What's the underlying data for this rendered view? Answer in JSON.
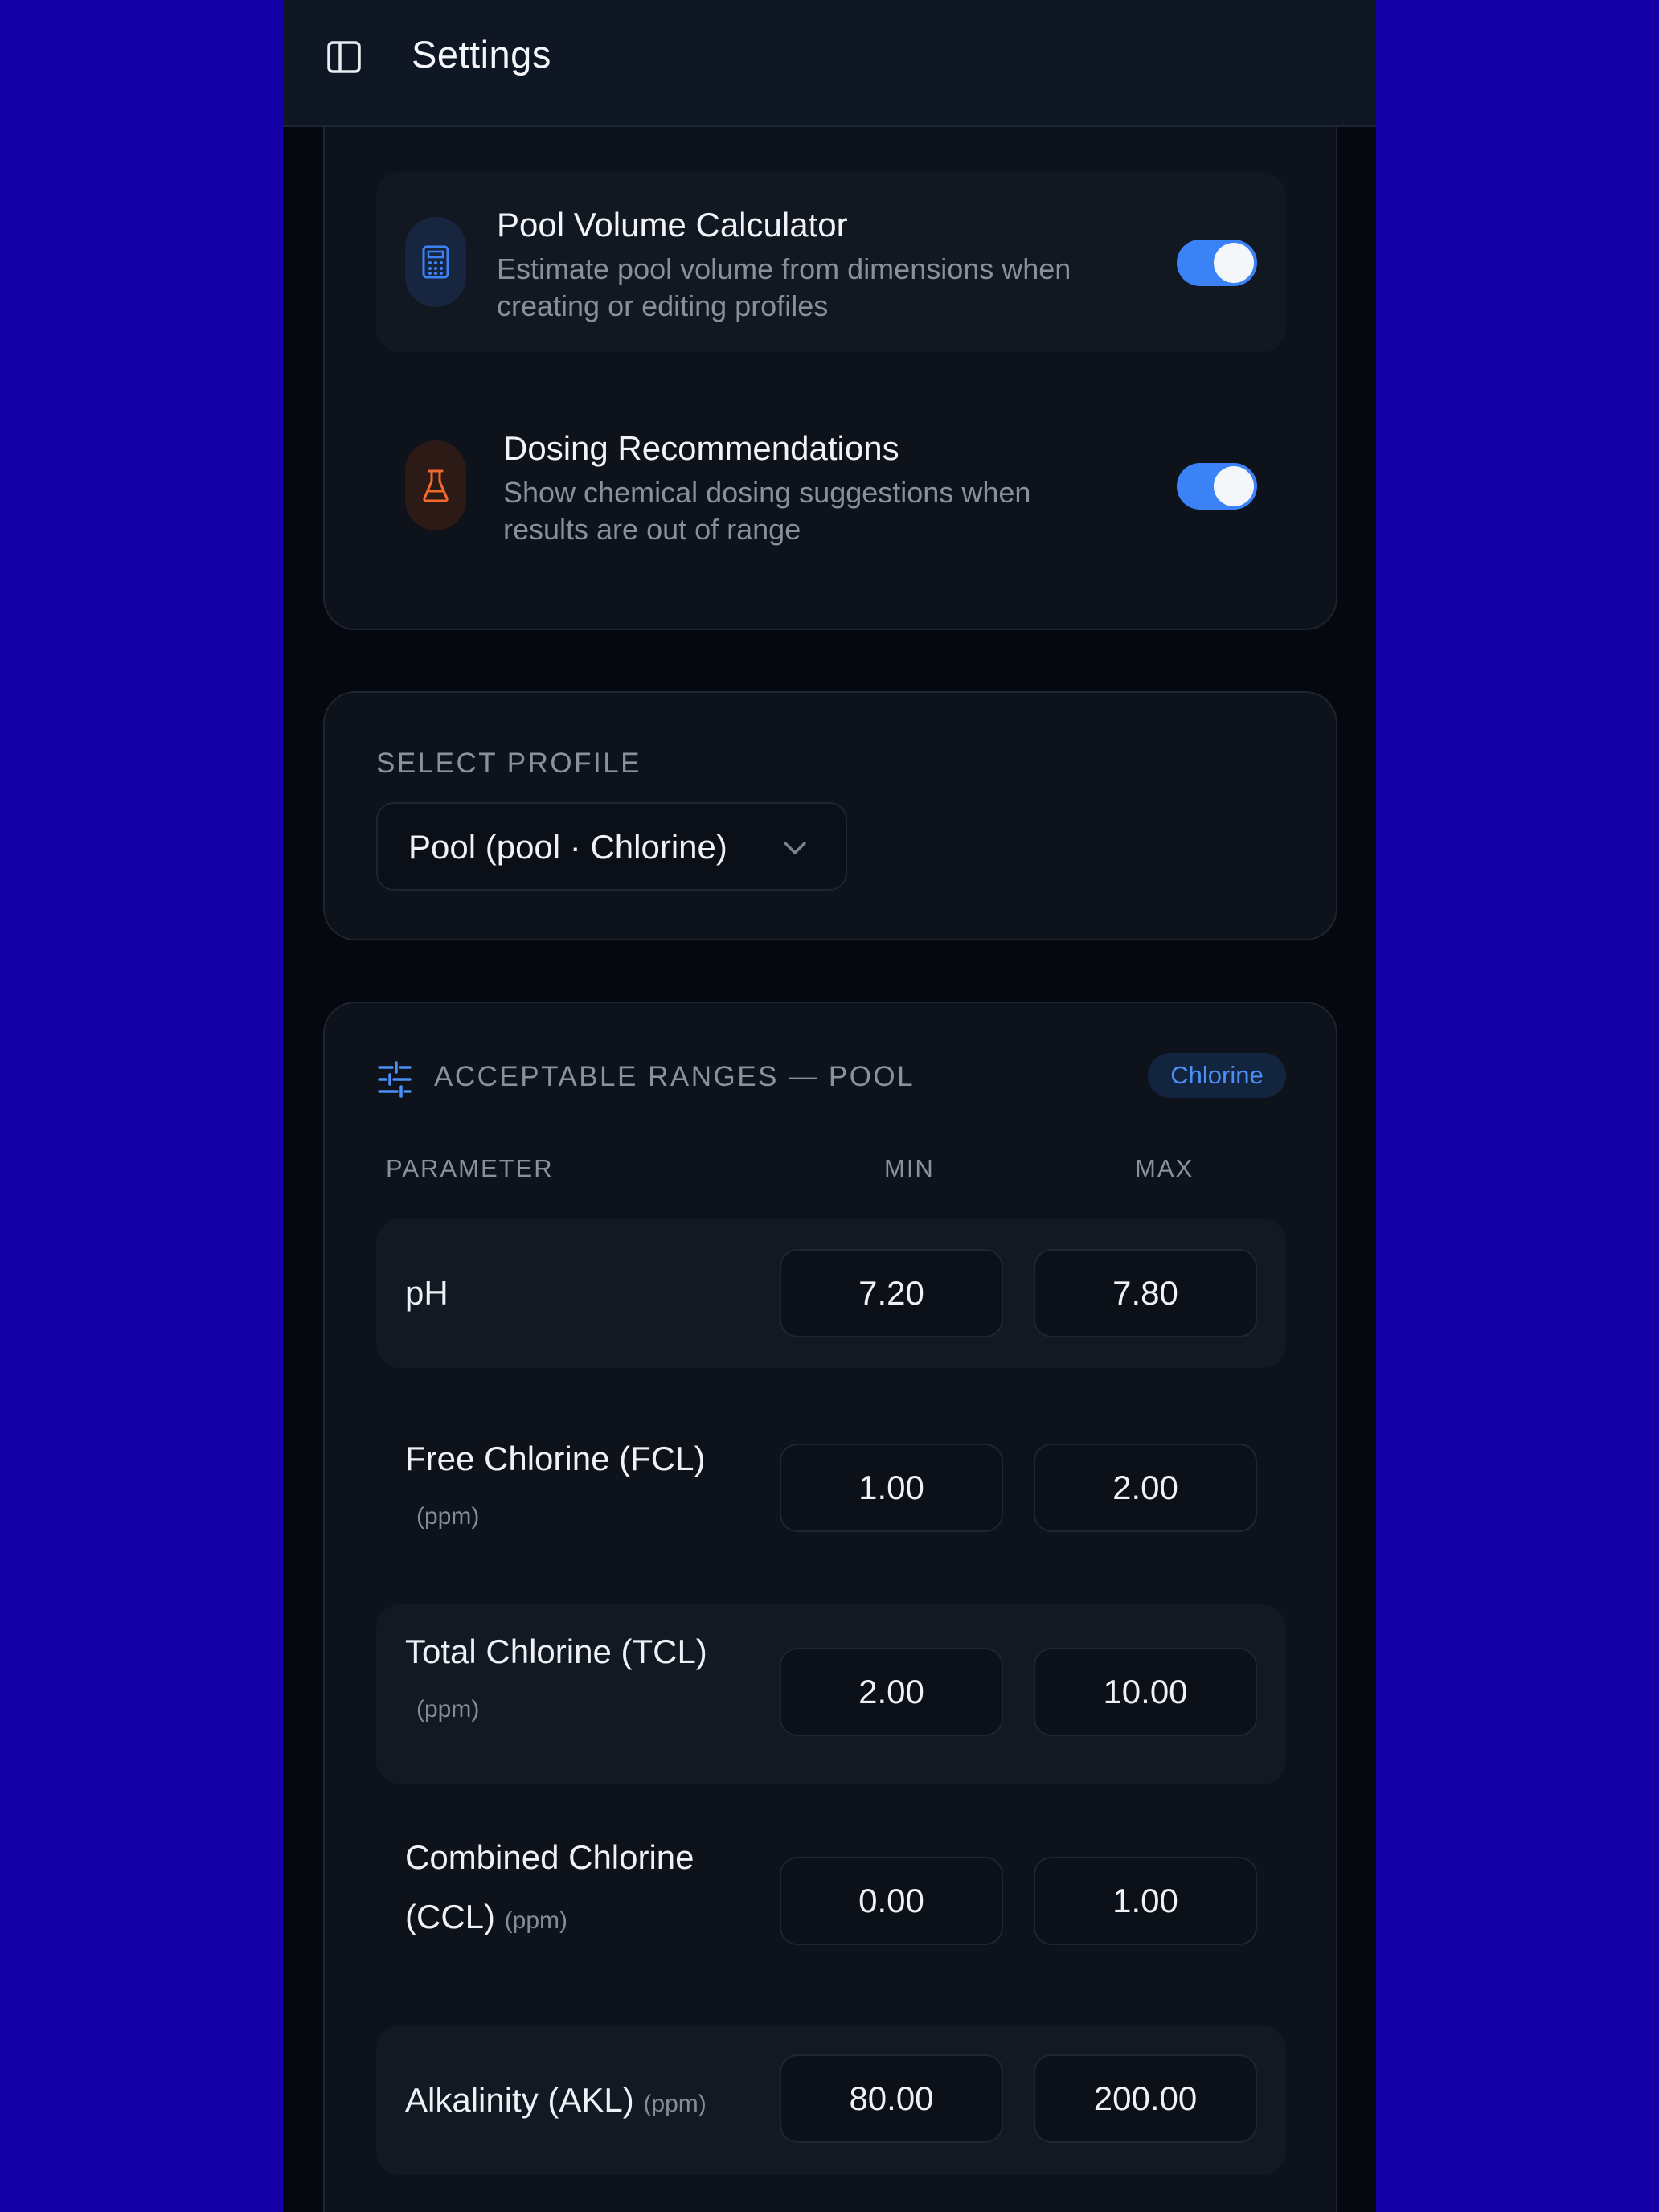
{
  "header": {
    "title": "Settings",
    "menu_icon": "sidebar-panel-icon"
  },
  "features": [
    {
      "title": "Pool Volume Calculator",
      "description_line1": "Estimate pool volume from dimensions when",
      "description_line2": "creating or editing profiles",
      "icon": "calculator-icon",
      "accent": "#3b82f6",
      "enabled": true
    },
    {
      "title": "Dosing Recommendations",
      "description_line1": "Show chemical dosing suggestions when",
      "description_line2": "results are out of range",
      "icon": "flask-icon",
      "accent": "#f06a2c",
      "enabled": true
    }
  ],
  "profile": {
    "label": "SELECT PROFILE",
    "selected": "Pool (pool · Chlorine)"
  },
  "ranges": {
    "title": "ACCEPTABLE RANGES — POOL",
    "badge": "Chlorine",
    "columns": {
      "parameter": "PARAMETER",
      "min": "MIN",
      "max": "MAX"
    },
    "rows": [
      {
        "name": "pH",
        "unit": "",
        "min": "7.20",
        "max": "7.80"
      },
      {
        "name": "Free Chlorine (FCL)",
        "unit": "(ppm)",
        "min": "1.00",
        "max": "2.00"
      },
      {
        "name": "Total Chlorine (TCL)",
        "unit": "(ppm)",
        "min": "2.00",
        "max": "10.00"
      },
      {
        "name_line1": "Combined Chlorine",
        "name_line2": "(CCL)",
        "unit": "(ppm)",
        "min": "0.00",
        "max": "1.00"
      },
      {
        "name": "Alkalinity (AKL)",
        "unit": "(ppm)",
        "min": "80.00",
        "max": "200.00"
      }
    ]
  },
  "colors": {
    "accent": "#3b82f6",
    "background": "#05080f",
    "outer": "#1400a6"
  }
}
